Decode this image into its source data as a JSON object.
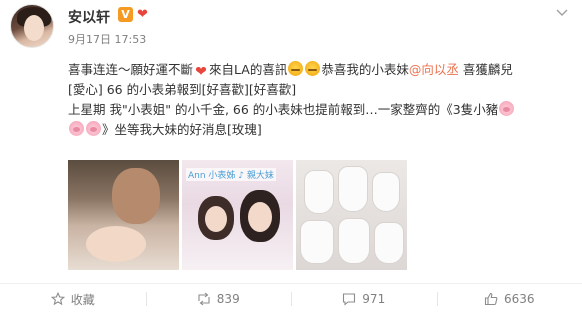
{
  "post": {
    "author_name": "安以轩",
    "verify_badge": "V",
    "time": "9月17日 17:53",
    "lines": [
      {
        "segments": [
          {
            "type": "text",
            "value": "喜事连连～願好運不斷"
          },
          {
            "type": "emoji",
            "name": "heart"
          },
          {
            "type": "text",
            "value": "來自LA的喜訊"
          },
          {
            "type": "emoji",
            "name": "cry"
          },
          {
            "type": "emoji",
            "name": "cry"
          },
          {
            "type": "text",
            "value": "恭喜我的小表妹"
          },
          {
            "type": "mention",
            "value": "@向以丞"
          },
          {
            "type": "text",
            "value": " 喜獲麟兒"
          }
        ]
      },
      {
        "segments": [
          {
            "type": "text",
            "value": "[愛心] 66 的小表弟報到[好喜歡][好喜歡]"
          }
        ]
      },
      {
        "segments": [
          {
            "type": "text",
            "value": "上星期 我\"小表姐\" 的小千金, 66 的小表妹也提前報到…一家整齊的《3隻小豬"
          },
          {
            "type": "emoji",
            "name": "pig"
          }
        ]
      },
      {
        "segments": [
          {
            "type": "emoji",
            "name": "pig"
          },
          {
            "type": "emoji",
            "name": "pig"
          },
          {
            "type": "text",
            "value": "》坐等我大妹的好消息[玫瑰]"
          }
        ]
      }
    ],
    "photos": [
      {
        "name": "photo-father-baby",
        "caption": ""
      },
      {
        "name": "photo-two-women",
        "caption": "Ann 小表姊 ♪ 親大妹"
      },
      {
        "name": "photo-baby-socks",
        "caption": ""
      }
    ]
  },
  "actions": {
    "favorite_label": "收藏",
    "repost_count": "839",
    "comment_count": "971",
    "like_count": "6636"
  },
  "colors": {
    "mention": "#eb7350",
    "verify_badge": "#f59a23",
    "meta_text": "#808080"
  },
  "icons": {
    "favorite": "star-icon",
    "repost": "repost-icon",
    "comment": "comment-icon",
    "like": "thumbs-up-icon",
    "more": "chevron-down-icon"
  }
}
